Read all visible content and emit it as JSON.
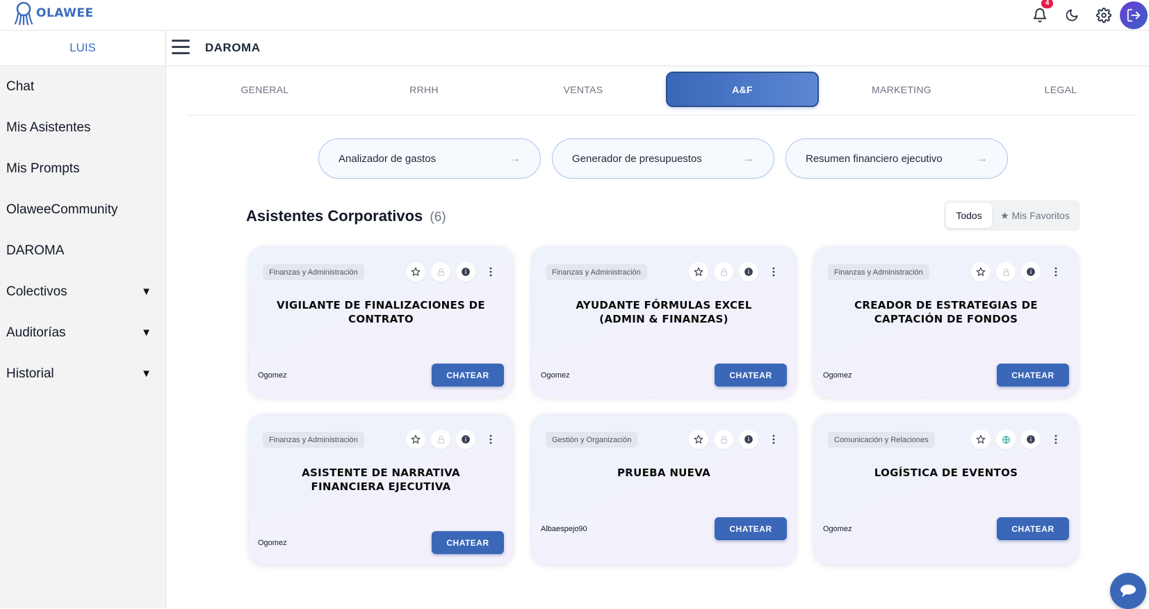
{
  "app": {
    "logo_text": "OLAWEE",
    "notifications_count": "4"
  },
  "sidebar": {
    "user": "LUIS",
    "items": [
      {
        "label": "Chat",
        "has_caret": false
      },
      {
        "label": "Mis Asistentes",
        "has_caret": false
      },
      {
        "label": "Mis Prompts",
        "has_caret": false
      },
      {
        "label": "OlaweeCommunity",
        "has_caret": false
      },
      {
        "label": "DAROMA",
        "has_caret": false
      },
      {
        "label": "Colectivos",
        "has_caret": true
      },
      {
        "label": "Auditorías",
        "has_caret": true
      },
      {
        "label": "Historial",
        "has_caret": true
      }
    ],
    "caret": "▼"
  },
  "header": {
    "org_title": "DAROMA"
  },
  "tabs": [
    {
      "label": "GENERAL"
    },
    {
      "label": "RRHH"
    },
    {
      "label": "VENTAS"
    },
    {
      "label": "A&F",
      "active": true
    },
    {
      "label": "MARKETING"
    },
    {
      "label": "LEGAL"
    }
  ],
  "prompts": [
    {
      "label": "Analizador de gastos",
      "arrow": "→"
    },
    {
      "label": "Generador de presupuestos",
      "arrow": "→"
    },
    {
      "label": "Resumen financiero ejecutivo",
      "arrow": "→"
    }
  ],
  "section": {
    "title": "Asistentes Corporativos",
    "count": "(6)",
    "filter_all": "Todos",
    "filter_favs": "★ Mis Favoritos"
  },
  "cards": [
    {
      "tag": "Finanzas y Administración",
      "title": "VIGILANTE DE FINALIZACIONES DE CONTRATO",
      "author": "Ogomez",
      "button": "CHATEAR",
      "lock_icon": "lock-icon"
    },
    {
      "tag": "Finanzas y Administración",
      "title": "AYUDANTE FÓRMULAS EXCEL (ADMIN & FINANZAS)",
      "author": "Ogomez",
      "button": "CHATEAR",
      "lock_icon": "lock-icon"
    },
    {
      "tag": "Finanzas y Administración",
      "title": "CREADOR DE ESTRATEGIAS DE CAPTACIÓN DE FONDOS",
      "author": "Ogomez",
      "button": "CHATEAR",
      "lock_icon": "lock-icon"
    },
    {
      "tag": "Finanzas y Administración",
      "title": "ASISTENTE DE NARRATIVA FINANCIERA EJECUTIVA",
      "author": "Ogomez",
      "button": "CHATEAR",
      "lock_icon": "lock-icon"
    },
    {
      "tag": "Gestión y Organización",
      "title": "PRUEBA NUEVA",
      "author": "Albaespejo90",
      "button": "CHATEAR",
      "lock_icon": "lock-icon"
    },
    {
      "tag": "Comunicación y Relaciones",
      "title": "LOGÍSTICA DE EVENTOS",
      "author": "Ogomez",
      "button": "CHATEAR",
      "lock_icon": "globe-icon"
    }
  ],
  "colors": {
    "accent": "#3a67b8",
    "brand": "#3a6cc0",
    "badge": "#e11d48"
  }
}
